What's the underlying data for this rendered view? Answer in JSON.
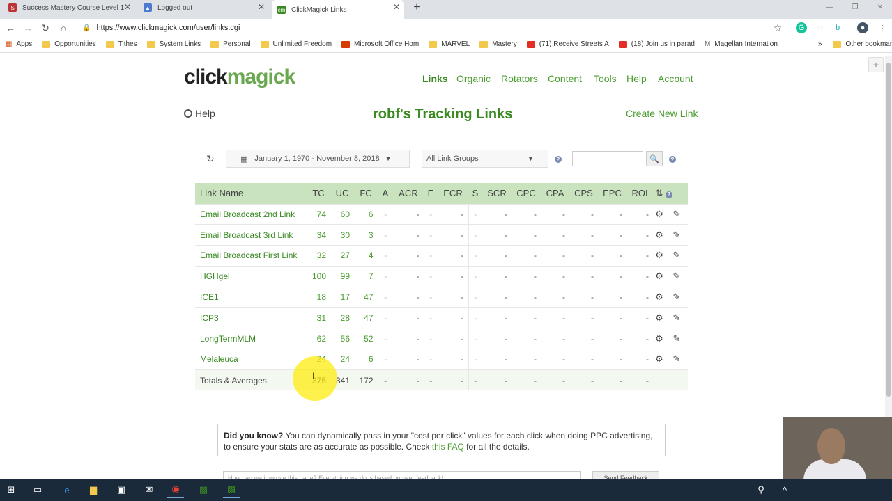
{
  "browser": {
    "tabs": [
      {
        "title": "Success Mastery Course Level 1"
      },
      {
        "title": "Logged out"
      },
      {
        "title": "ClickMagick Links"
      }
    ],
    "url": "https://www.clickmagick.com/user/links.cgi",
    "bookmarks": [
      "Apps",
      "Opportunities",
      "Tithes",
      "System Links",
      "Personal",
      "Unlimited Freedom",
      "Microsoft Office Hom",
      "MARVEL",
      "Mastery",
      "(71) Receive Streets A",
      "(18) Join us in parad",
      "Magellan Internation"
    ],
    "other_bookmarks": "Other bookmarks"
  },
  "site": {
    "logo_part1": "click",
    "logo_part2": "magick",
    "nav": [
      "Links",
      "Organic",
      "Rotators",
      "Content",
      "Tools",
      "Help",
      "Account"
    ],
    "help_label": "Help",
    "page_title": "robf's Tracking Links",
    "create_label": "Create New Link"
  },
  "filters": {
    "date_range": "January 1, 1970 - November 8, 2018",
    "link_group": "All Link Groups",
    "search_placeholder": ""
  },
  "table": {
    "headers": [
      "Link Name",
      "TC",
      "UC",
      "FC",
      "A",
      "ACR",
      "E",
      "ECR",
      "S",
      "SCR",
      "CPC",
      "CPA",
      "CPS",
      "EPC",
      "ROI"
    ],
    "rows": [
      {
        "name": "Email Broadcast 2nd Link",
        "tc": "74",
        "uc": "60",
        "fc": "6"
      },
      {
        "name": "Email Broadcast 3rd Link",
        "tc": "34",
        "uc": "30",
        "fc": "3"
      },
      {
        "name": "Email Broadcast First Link",
        "tc": "32",
        "uc": "27",
        "fc": "4"
      },
      {
        "name": "HGHgel",
        "tc": "100",
        "uc": "99",
        "fc": "7"
      },
      {
        "name": "ICE1",
        "tc": "18",
        "uc": "17",
        "fc": "47"
      },
      {
        "name": "ICP3",
        "tc": "31",
        "uc": "28",
        "fc": "47"
      },
      {
        "name": "LongTermMLM",
        "tc": "62",
        "uc": "56",
        "fc": "52"
      },
      {
        "name": "Melaleuca",
        "tc": "24",
        "uc": "24",
        "fc": "6"
      }
    ],
    "totals": {
      "name": "Totals & Averages",
      "tc": "375",
      "uc": "341",
      "fc": "172"
    },
    "dash": "-"
  },
  "tip": {
    "bold": "Did you know?",
    "text": " You can dynamically pass in your \"cost per click\" values for each click when doing PPC advertising, to ensure your stats are as accurate as possible. Check ",
    "link": "this FAQ",
    "tail": " for all the details."
  },
  "feedback": {
    "placeholder": "How can we improve this page? Everything we do is based on user feedback!",
    "button": "Send Feedback"
  }
}
